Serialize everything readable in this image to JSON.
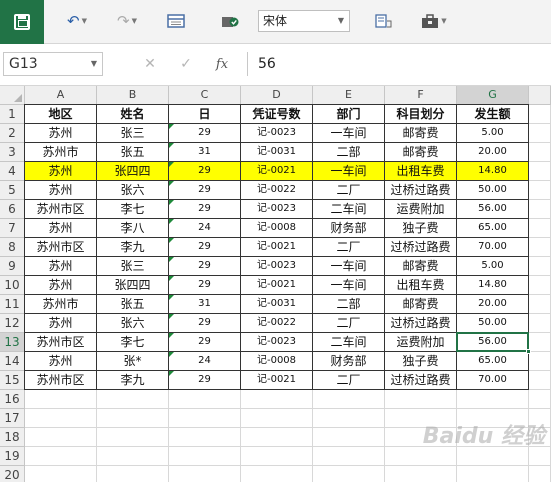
{
  "toolbar": {
    "font_name": "宋体"
  },
  "formula_bar": {
    "name_box": "G13",
    "value": "56",
    "fx_label": "fx"
  },
  "columns": [
    "A",
    "B",
    "C",
    "D",
    "E",
    "F",
    "G"
  ],
  "selected_column": "G",
  "selected_row": 13,
  "row_numbers": [
    1,
    2,
    3,
    4,
    5,
    6,
    7,
    8,
    9,
    10,
    11,
    12,
    13,
    14,
    15,
    16,
    17,
    18,
    19,
    20
  ],
  "table": {
    "headers": [
      "地区",
      "姓名",
      "日",
      "凭证号数",
      "部门",
      "科目划分",
      "发生额"
    ],
    "rows": [
      [
        "苏州",
        "张三",
        "29",
        "记-0023",
        "一车间",
        "邮寄费",
        "5.00"
      ],
      [
        "苏州市",
        "张五",
        "31",
        "记-0031",
        "二部",
        "邮寄费",
        "20.00"
      ],
      [
        "苏州",
        "张四四",
        "29",
        "记-0021",
        "一车间",
        "出租车费",
        "14.80"
      ],
      [
        "苏州",
        "张六",
        "29",
        "记-0022",
        "二厂",
        "过桥过路费",
        "50.00"
      ],
      [
        "苏州市区",
        "李七",
        "29",
        "记-0023",
        "二车间",
        "运费附加",
        "56.00"
      ],
      [
        "苏州",
        "李八",
        "24",
        "记-0008",
        "财务部",
        "独子费",
        "65.00"
      ],
      [
        "苏州市区",
        "李九",
        "29",
        "记-0021",
        "二厂",
        "过桥过路费",
        "70.00"
      ],
      [
        "苏州",
        "张三",
        "29",
        "记-0023",
        "一车间",
        "邮寄费",
        "5.00"
      ],
      [
        "苏州",
        "张四四",
        "29",
        "记-0021",
        "一车间",
        "出租车费",
        "14.80"
      ],
      [
        "苏州市",
        "张五",
        "31",
        "记-0031",
        "二部",
        "邮寄费",
        "20.00"
      ],
      [
        "苏州",
        "张六",
        "29",
        "记-0022",
        "二厂",
        "过桥过路费",
        "50.00"
      ],
      [
        "苏州市区",
        "李七",
        "29",
        "记-0023",
        "二车间",
        "运费附加",
        "56.00"
      ],
      [
        "苏州",
        "张*",
        "24",
        "记-0008",
        "财务部",
        "独子费",
        "65.00"
      ],
      [
        "苏州市区",
        "李九",
        "29",
        "记-0021",
        "二厂",
        "过桥过路费",
        "70.00"
      ]
    ],
    "highlighted_row_index": 2,
    "highlight_color": "#ffff00"
  },
  "watermark": "Baidu 经验",
  "colors": {
    "accent": "#217346",
    "highlight": "#ffff00"
  }
}
